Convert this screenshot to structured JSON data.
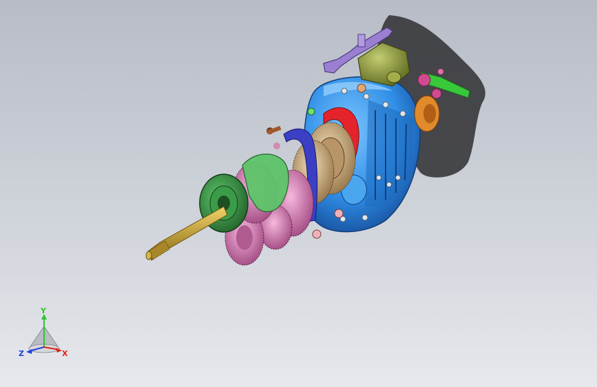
{
  "scene": {
    "model": "gearbox-assembly",
    "colors": {
      "background_top": "#b7bcc6",
      "background_bottom": "#e6e8ec",
      "housing": "#2f8fe6",
      "flange": "#2e8b3a",
      "shaft": "#c9a227",
      "gear_pink": "#d87ab5",
      "gear_bronze": "#c9a77a",
      "fork_blue": "#3a3fc4",
      "fork_red": "#e5232b",
      "bracket_purple": "#9b7fd1",
      "shifter_olive": "#8f9a3a",
      "lever_green": "#38c93a",
      "shadow": "#2f2f33"
    }
  },
  "triad": {
    "x_label": "X",
    "y_label": "Y",
    "z_label": "Z",
    "x_color": "#e0241b",
    "y_color": "#2cc52c",
    "z_color": "#1f3fe0"
  }
}
